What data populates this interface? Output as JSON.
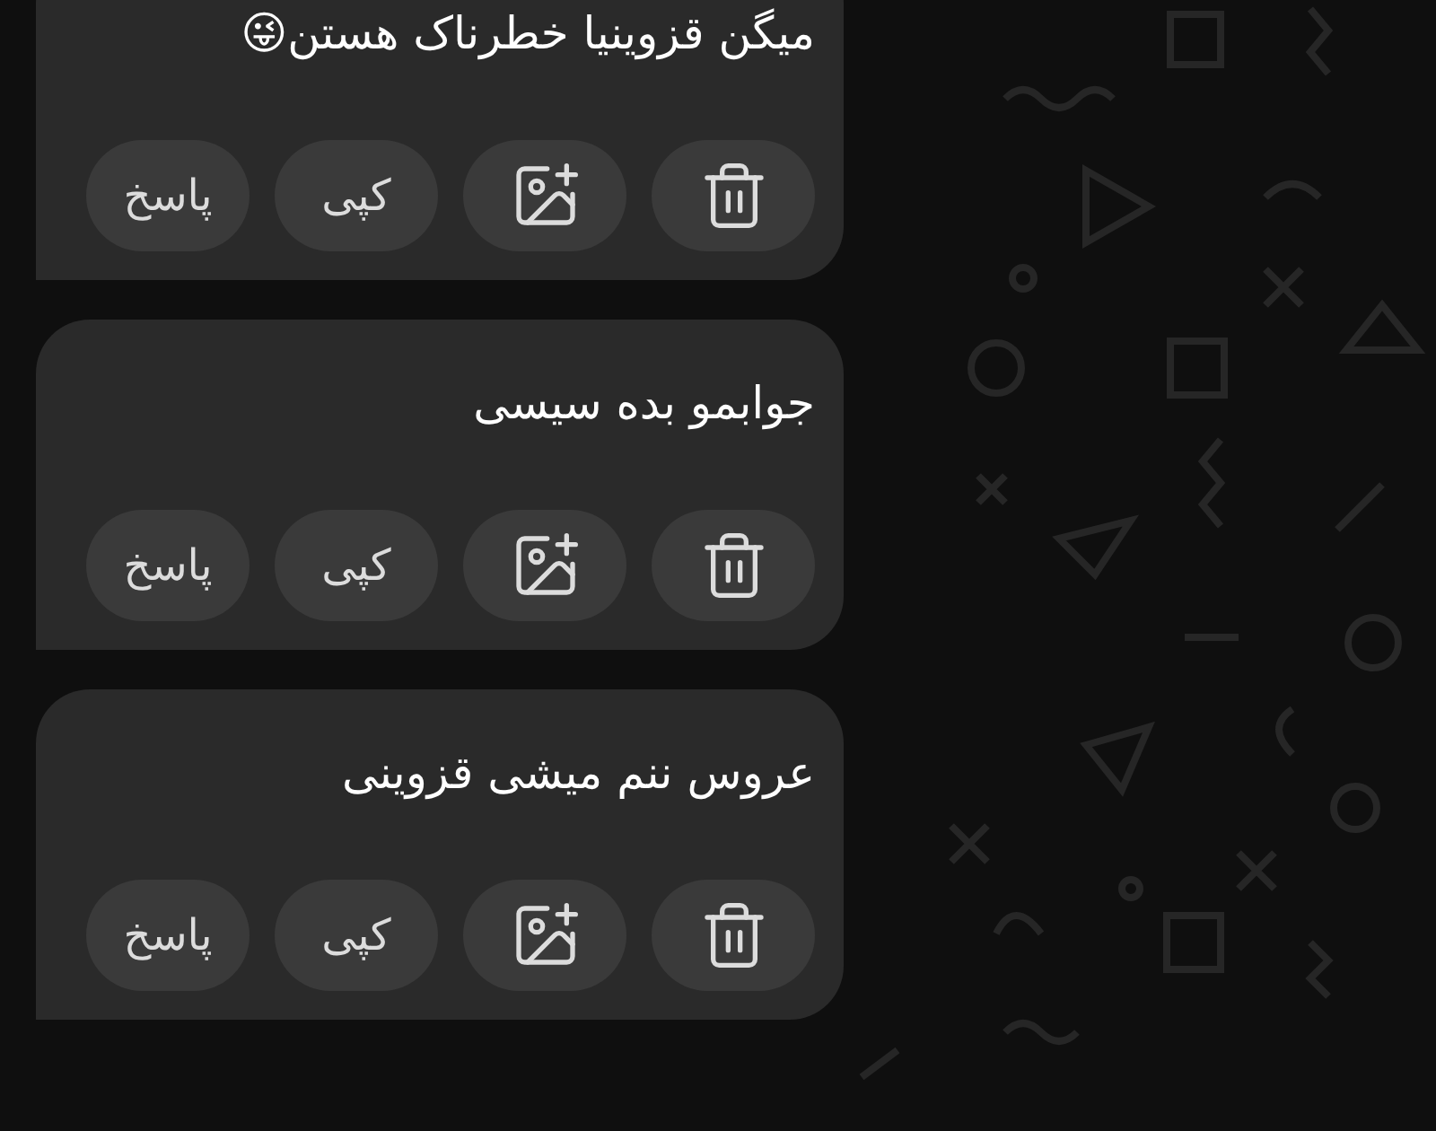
{
  "messages": [
    {
      "text": "میگن قزوینیا خطرناک هستن😜",
      "actions": [
        {
          "kind": "delete"
        },
        {
          "kind": "image"
        },
        {
          "kind": "copy",
          "label": "کپی"
        },
        {
          "kind": "reply",
          "label": "پاسخ"
        }
      ]
    },
    {
      "text": "جوابمو بده سیسی",
      "actions": [
        {
          "kind": "delete"
        },
        {
          "kind": "image"
        },
        {
          "kind": "copy",
          "label": "کپی"
        },
        {
          "kind": "reply",
          "label": "پاسخ"
        }
      ]
    },
    {
      "text": "عروس ننم میشی قزوینی",
      "actions": [
        {
          "kind": "delete"
        },
        {
          "kind": "image"
        },
        {
          "kind": "copy",
          "label": "کپی"
        },
        {
          "kind": "reply",
          "label": "پاسخ"
        }
      ]
    }
  ]
}
